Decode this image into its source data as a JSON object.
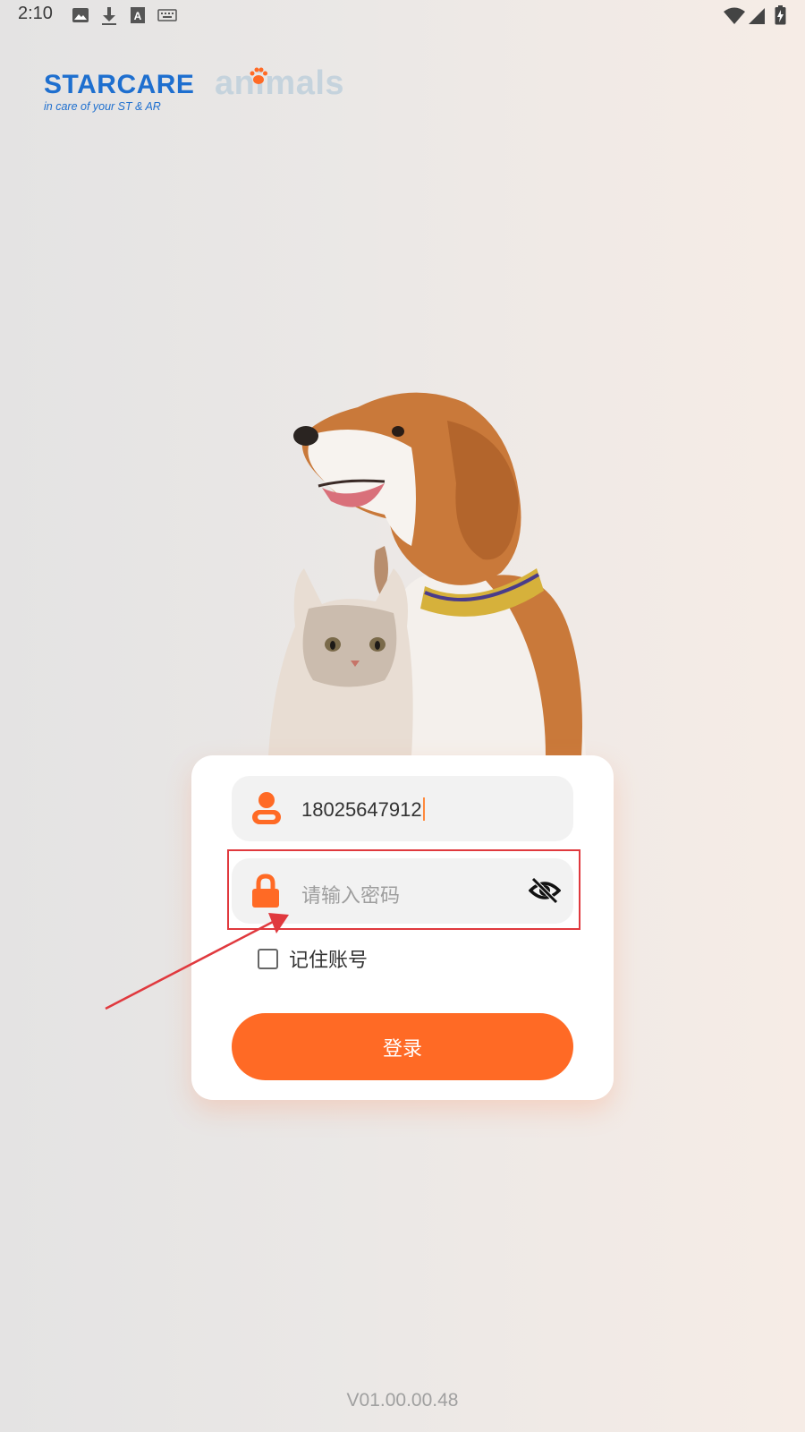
{
  "status_bar": {
    "time": "2:10",
    "left_icons": [
      "image-icon",
      "download-icon",
      "font-icon",
      "keyboard-icon"
    ],
    "right_icons": [
      "wifi-icon",
      "signal-icon",
      "battery-icon"
    ]
  },
  "header": {
    "logo_brand": "STARCARE",
    "logo_tagline": "in care of your ST & AR",
    "logo_animals": "animals"
  },
  "login": {
    "username_value": "18025647912",
    "password_placeholder": "请输入密码",
    "remember_label": "记住账号",
    "remember_checked": false,
    "login_button": "登录"
  },
  "footer": {
    "version": "V01.00.00.48"
  },
  "colors": {
    "accent": "#ff6a25",
    "brand_blue": "#1e6fcf",
    "annotation_red": "#e0393e"
  }
}
